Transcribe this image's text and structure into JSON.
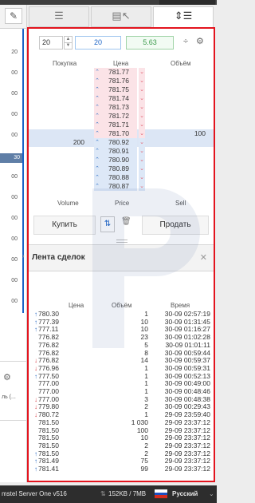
{
  "left_panel": {
    "numbers": [
      "20",
      "00",
      "00",
      "00",
      "00",
      "30",
      "00",
      "00",
      "00",
      "00",
      "00",
      "00",
      "00"
    ],
    "selected_index": 5,
    "footer_text": "ль (..."
  },
  "tabs": [
    {
      "icon": "list-icon"
    },
    {
      "icon": "order-book-cursor-icon"
    },
    {
      "icon": "sort-list-icon"
    }
  ],
  "controls": {
    "quantity": "20",
    "value_blue": "20",
    "value_green": "5.63"
  },
  "ladder": {
    "headers": {
      "bid": "Покупка",
      "price": "Цена",
      "ask": "Объём"
    },
    "rows": [
      {
        "bid": "",
        "price": "781.77",
        "ask": "",
        "zone": "ask"
      },
      {
        "bid": "",
        "price": "781.76",
        "ask": "",
        "zone": "ask"
      },
      {
        "bid": "",
        "price": "781.75",
        "ask": "",
        "zone": "ask"
      },
      {
        "bid": "",
        "price": "781.74",
        "ask": "",
        "zone": "ask"
      },
      {
        "bid": "",
        "price": "781.73",
        "ask": "",
        "zone": "ask"
      },
      {
        "bid": "",
        "price": "781.72",
        "ask": "",
        "zone": "ask"
      },
      {
        "bid": "",
        "price": "781.71",
        "ask": "",
        "zone": "ask"
      },
      {
        "bid": "",
        "price": "781.70",
        "ask": "100",
        "zone": "best-ask"
      },
      {
        "bid": "200",
        "price": "780.92",
        "ask": "",
        "zone": "best-bid"
      },
      {
        "bid": "",
        "price": "780.91",
        "ask": "",
        "zone": "bid"
      },
      {
        "bid": "",
        "price": "780.90",
        "ask": "",
        "zone": "bid"
      },
      {
        "bid": "",
        "price": "780.89",
        "ask": "",
        "zone": "bid"
      },
      {
        "bid": "",
        "price": "780.88",
        "ask": "",
        "zone": "bid"
      },
      {
        "bid": "",
        "price": "780.87",
        "ask": "",
        "zone": "bid"
      }
    ],
    "footer": {
      "volume": "Volume",
      "price": "Price",
      "sell": "Sell"
    }
  },
  "actions": {
    "buy": "Купить",
    "sell": "Продать"
  },
  "trades": {
    "title": "Лента сделок",
    "headers": {
      "price": "Цена",
      "volume": "Объём",
      "time": "Время"
    },
    "rows": [
      {
        "dir": "up",
        "price": "780.30",
        "volume": "1",
        "time": "30-09 02:57:19"
      },
      {
        "dir": "up",
        "price": "777.39",
        "volume": "10",
        "time": "30-09 01:31:45"
      },
      {
        "dir": "up",
        "price": "777.11",
        "volume": "10",
        "time": "30-09 01:16:27"
      },
      {
        "dir": "",
        "price": "776.82",
        "volume": "23",
        "time": "30-09 01:02:28"
      },
      {
        "dir": "",
        "price": "776.82",
        "volume": "5",
        "time": "30-09 01:01:11"
      },
      {
        "dir": "",
        "price": "776.82",
        "volume": "8",
        "time": "30-09 00:59:44"
      },
      {
        "dir": "down",
        "price": "776.82",
        "volume": "14",
        "time": "30-09 00:59:37"
      },
      {
        "dir": "down",
        "price": "776.96",
        "volume": "1",
        "time": "30-09 00:59:31"
      },
      {
        "dir": "up",
        "price": "777.50",
        "volume": "1",
        "time": "30-09 00:52:13"
      },
      {
        "dir": "",
        "price": "777.00",
        "volume": "1",
        "time": "30-09 00:49:00"
      },
      {
        "dir": "",
        "price": "777.00",
        "volume": "1",
        "time": "30-09 00:48:46"
      },
      {
        "dir": "down",
        "price": "777.00",
        "volume": "3",
        "time": "30-09 00:48:38"
      },
      {
        "dir": "down",
        "price": "779.80",
        "volume": "2",
        "time": "30-09 00:29:43"
      },
      {
        "dir": "down",
        "price": "780.72",
        "volume": "1",
        "time": "29-09 23:59:40"
      },
      {
        "dir": "",
        "price": "781.50",
        "volume": "1 030",
        "time": "29-09 23:37:12"
      },
      {
        "dir": "",
        "price": "781.50",
        "volume": "100",
        "time": "29-09 23:37:12"
      },
      {
        "dir": "",
        "price": "781.50",
        "volume": "10",
        "time": "29-09 23:37:12"
      },
      {
        "dir": "",
        "price": "781.50",
        "volume": "2",
        "time": "29-09 23:37:12"
      },
      {
        "dir": "up",
        "price": "781.50",
        "volume": "2",
        "time": "29-09 23:37:12"
      },
      {
        "dir": "up",
        "price": "781.49",
        "volume": "75",
        "time": "29-09 23:37:12"
      },
      {
        "dir": "up",
        "price": "781.41",
        "volume": "99",
        "time": "29-09 23:37:12"
      }
    ]
  },
  "statusbar": {
    "server": "mstel Server One v516",
    "traffic": "152KB / 7MB",
    "language": "Русский"
  },
  "colors": {
    "accent_red": "#e3141e",
    "accent_blue": "#1a63c7",
    "trade_up": "#2b6cc4",
    "trade_down": "#d7373f"
  }
}
